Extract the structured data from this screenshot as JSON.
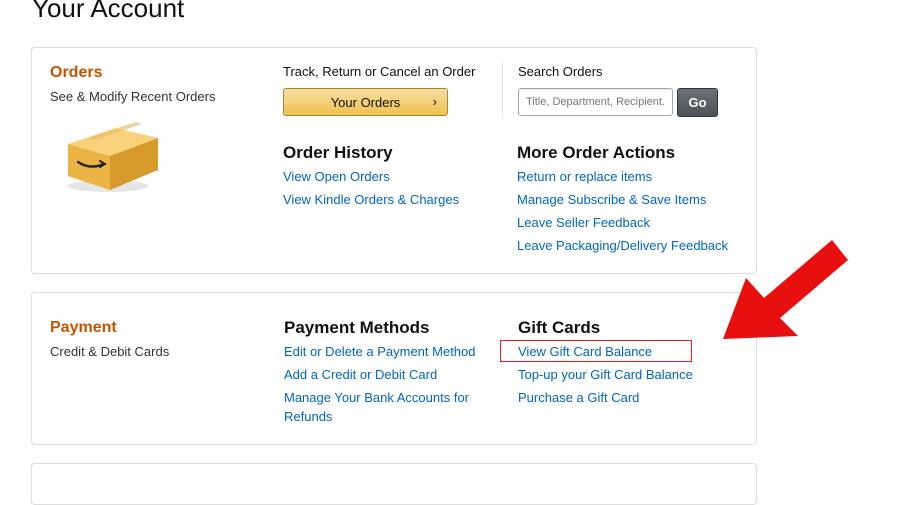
{
  "page": {
    "title": "Your Account"
  },
  "orders": {
    "title": "Orders",
    "subtitle": "See & Modify Recent Orders",
    "track_label": "Track, Return or Cancel an Order",
    "your_orders_button": "Your Orders",
    "your_orders_chevron": "›",
    "search_label": "Search Orders",
    "search_placeholder": "Title, Department, Recipient...",
    "search_value": "",
    "go_button": "Go",
    "history": {
      "title": "Order History",
      "links": [
        "View Open Orders",
        "View Kindle Orders & Charges"
      ]
    },
    "more_actions": {
      "title": "More Order Actions",
      "links": [
        "Return or replace items",
        "Manage Subscribe & Save Items",
        "Leave Seller Feedback",
        "Leave Packaging/Delivery Feedback"
      ]
    }
  },
  "payment": {
    "title": "Payment",
    "subtitle": "Credit & Debit Cards",
    "methods": {
      "title": "Payment Methods",
      "links": [
        "Edit or Delete a Payment Method",
        "Add a Credit or Debit Card",
        "Manage Your Bank Accounts for Refunds"
      ]
    },
    "gift_cards": {
      "title": "Gift Cards",
      "links": [
        "View Gift Card Balance",
        "Top-up your Gift Card Balance",
        "Purchase a Gift Card"
      ]
    }
  },
  "annotation": {
    "highlight_color": "#e02020",
    "arrow_color": "#e80f0f"
  },
  "colors": {
    "section_title": "#c45500",
    "link": "#0066c0",
    "button": "#f0c14b"
  }
}
